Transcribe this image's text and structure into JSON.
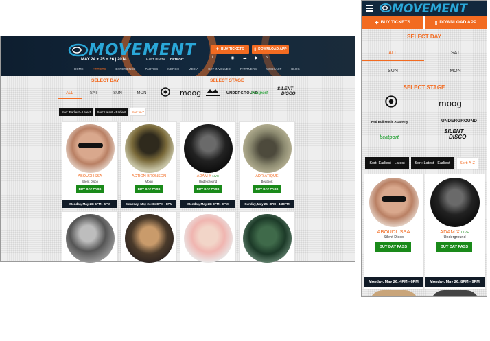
{
  "brand": {
    "logo_text": "MOVEMENT",
    "dates": "MAY 24 + 25 + 26 | 2014",
    "venue": "HART PLAZA",
    "city": "DETROIT",
    "accent_color": "#f26b21",
    "logo_color": "#2aa7d8",
    "header_bg": "#12283d"
  },
  "header_buttons": {
    "buy_tickets": "BUY TICKETS",
    "download_app": "DOWNLOAD APP",
    "ticket_icon": "ticket-icon",
    "phone_icon": "phone-icon"
  },
  "social": [
    "facebook-icon",
    "twitter-icon",
    "instagram-icon",
    "soundcloud-icon",
    "youtube-icon",
    "vimeo-icon"
  ],
  "social_glyphs": [
    "f",
    "t",
    "◉",
    "☁",
    "▶",
    "v"
  ],
  "nav": {
    "items": [
      "HOME",
      "ARTISTS",
      "EXPERIENCE",
      "PARTIES",
      "MERCH",
      "MEDIA",
      "GET INVOLVED",
      "PARTNERS",
      "WEBCAST",
      "BLOG"
    ],
    "active": "ARTISTS"
  },
  "filters": {
    "select_day": "SELECT DAY",
    "select_stage": "SELECT STAGE",
    "days": [
      "ALL",
      "SAT",
      "SUN",
      "MON"
    ],
    "active_day": "ALL",
    "stages": {
      "redbull": "Red Bull Music Academy",
      "moog": "moog",
      "underground": "UNDERGROUND",
      "beatport": "beatport",
      "silent_line1": "SILENT",
      "silent_line2": "DISCO"
    }
  },
  "sort": {
    "earliest_latest": "Sort: Earliest - Latest",
    "latest_earliest": "Sort: Latest - Earliest",
    "az": "Sort: A-Z"
  },
  "buy_label": "BUY DAY PASS",
  "artists": [
    {
      "name": "ABOUDI ISSA",
      "live": "",
      "stage": "Silent Disco",
      "date": "Monday, May 26: 4PM - 6PM"
    },
    {
      "name": "ACTION BRONSON",
      "live": "",
      "stage": "Moog",
      "date": "Saturday, May 24: 6:30PM - 8PM"
    },
    {
      "name": "ADAM X",
      "live": "LIVE",
      "stage": "Underground",
      "date": "Monday, May 26: 8PM - 9PM"
    },
    {
      "name": "ADRIATIQUE",
      "live": "",
      "stage": "Beatport",
      "date": "Sunday, May 25: 3PM - 4:30PM"
    }
  ]
}
